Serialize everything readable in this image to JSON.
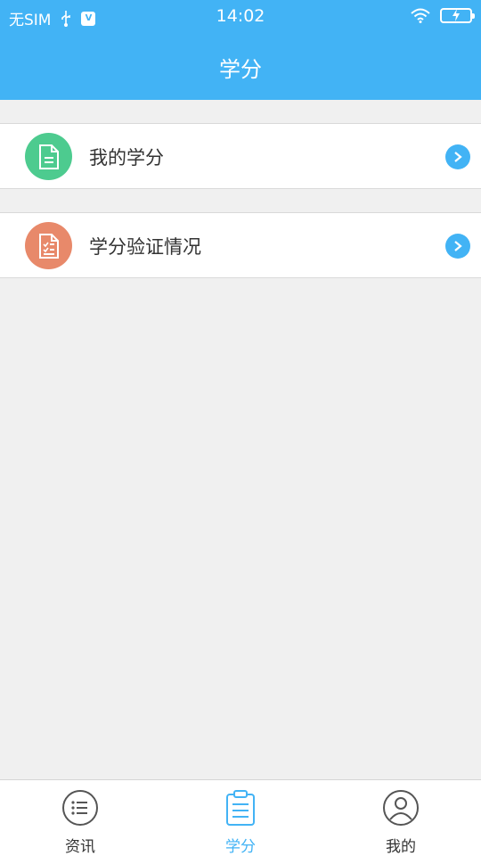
{
  "status_bar": {
    "carrier": "无SIM",
    "time": "14:02",
    "icons": [
      "usb-icon",
      "vpn-icon",
      "wifi-icon",
      "battery-charging-icon"
    ]
  },
  "header": {
    "title": "学分"
  },
  "list": [
    {
      "label": "我的学分",
      "icon": "document-icon",
      "color": "#4dcb8f"
    },
    {
      "label": "学分验证情况",
      "icon": "checklist-icon",
      "color": "#e8896a"
    }
  ],
  "tabbar": {
    "tabs": [
      {
        "label": "资讯",
        "icon": "list-icon",
        "active": false
      },
      {
        "label": "学分",
        "icon": "clipboard-icon",
        "active": true
      },
      {
        "label": "我的",
        "icon": "user-icon",
        "active": false
      }
    ]
  },
  "colors": {
    "accent": "#42b3f5",
    "background": "#f0f0f0"
  }
}
